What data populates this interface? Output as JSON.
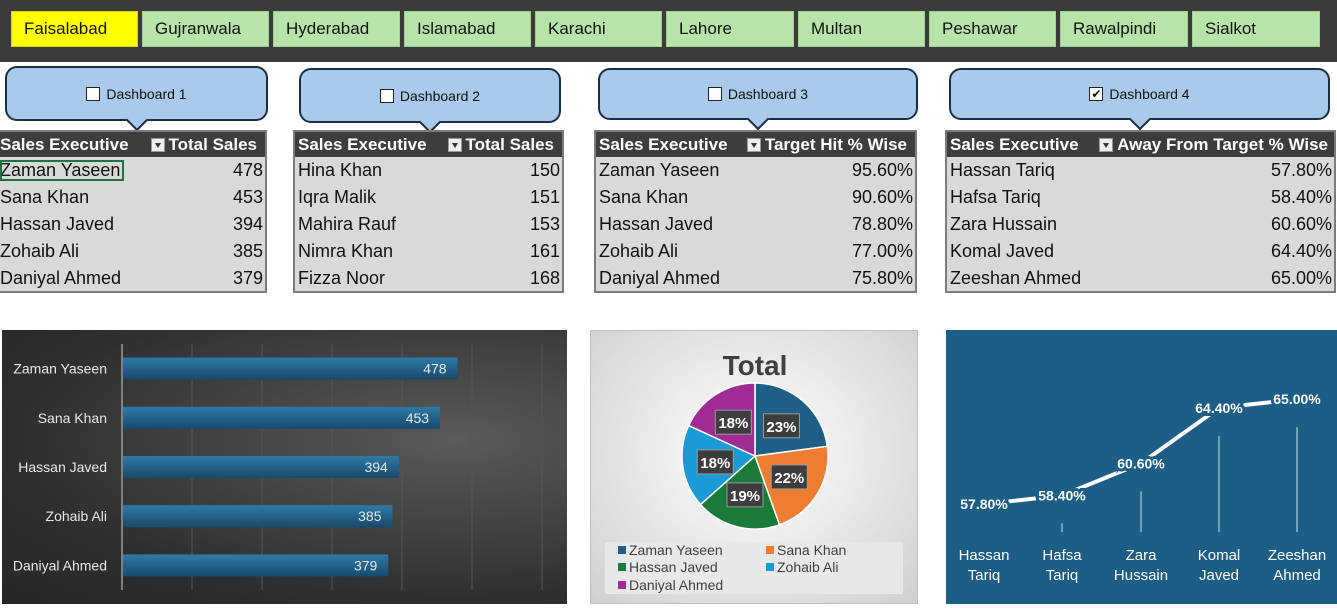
{
  "slicer": {
    "cities": [
      "Faisalabad",
      "Gujranwala",
      "Hyderabad",
      "Islamabad",
      "Karachi",
      "Lahore",
      "Multan",
      "Peshawar",
      "Rawalpindi",
      "Sialkot"
    ],
    "selected": "Faisalabad",
    "active_color": "#ffff00",
    "inactive_color": "#b7e4a8"
  },
  "dashboards": [
    {
      "label": "Dashboard 1",
      "checked": false
    },
    {
      "label": "Dashboard 2",
      "checked": false
    },
    {
      "label": "Dashboard 3",
      "checked": false
    },
    {
      "label": "Dashboard 4",
      "checked": true
    }
  ],
  "tables": [
    {
      "col1": "Sales Executive",
      "col2": "Total Sales",
      "rows": [
        [
          "Zaman Yaseen",
          "478"
        ],
        [
          "Sana Khan",
          "453"
        ],
        [
          "Hassan Javed",
          "394"
        ],
        [
          "Zohaib Ali",
          "385"
        ],
        [
          "Daniyal Ahmed",
          "379"
        ]
      ]
    },
    {
      "col1": "Sales Executive",
      "col2": "Total Sales",
      "rows": [
        [
          "Hina Khan",
          "150"
        ],
        [
          "Iqra Malik",
          "151"
        ],
        [
          "Mahira Rauf",
          "153"
        ],
        [
          "Nimra Khan",
          "161"
        ],
        [
          "Fizza Noor",
          "168"
        ]
      ]
    },
    {
      "col1": "Sales Executive",
      "col2": "Target Hit % Wise",
      "rows": [
        [
          "Zaman Yaseen",
          "95.60%"
        ],
        [
          "Sana Khan",
          "90.60%"
        ],
        [
          "Hassan Javed",
          "78.80%"
        ],
        [
          "Zohaib Ali",
          "77.00%"
        ],
        [
          "Daniyal Ahmed",
          "75.80%"
        ]
      ]
    },
    {
      "col1": "Sales Executive",
      "col2": "Away From Target % Wise",
      "rows": [
        [
          "Hassan Tariq",
          "57.80%"
        ],
        [
          "Hafsa Tariq",
          "58.40%"
        ],
        [
          "Zara Hussain",
          "60.60%"
        ],
        [
          "Komal Javed",
          "64.40%"
        ],
        [
          "Zeeshan Ahmed",
          "65.00%"
        ]
      ]
    }
  ],
  "chart_data": [
    {
      "type": "bar",
      "orientation": "horizontal",
      "categories": [
        "Zaman Yaseen",
        "Sana Khan",
        "Hassan Javed",
        "Zohaib Ali",
        "Daniyal Ahmed"
      ],
      "values": [
        478,
        453,
        394,
        385,
        379
      ],
      "data_labels": [
        "478",
        "453",
        "394",
        "385",
        "379"
      ],
      "xlim": [
        0,
        600
      ],
      "grid": true,
      "bar_color": "#1f5f87",
      "background": "#2e2e2e"
    },
    {
      "type": "pie",
      "title": "Total",
      "categories": [
        "Zaman Yaseen",
        "Sana Khan",
        "Hassan Javed",
        "Zohaib Ali",
        "Daniyal Ahmed"
      ],
      "values": [
        478,
        453,
        394,
        385,
        379
      ],
      "data_labels": [
        "23%",
        "22%",
        "19%",
        "18%",
        "18%"
      ],
      "colors": [
        "#1f5f87",
        "#ed7d31",
        "#197a3a",
        "#1a9ad6",
        "#a02b93"
      ],
      "legend": "bottom"
    },
    {
      "type": "line",
      "categories": [
        "Hassan Tariq",
        "Hafsa Tariq",
        "Zara Hussain",
        "Komal Javed",
        "Zeeshan Ahmed"
      ],
      "values": [
        57.8,
        58.4,
        60.6,
        64.4,
        65.0
      ],
      "data_labels": [
        "57.80%",
        "58.40%",
        "60.60%",
        "64.40%",
        "65.00%"
      ],
      "ylim": [
        55,
        67
      ],
      "line_color": "#ffffff",
      "background": "#1d5e86"
    }
  ]
}
